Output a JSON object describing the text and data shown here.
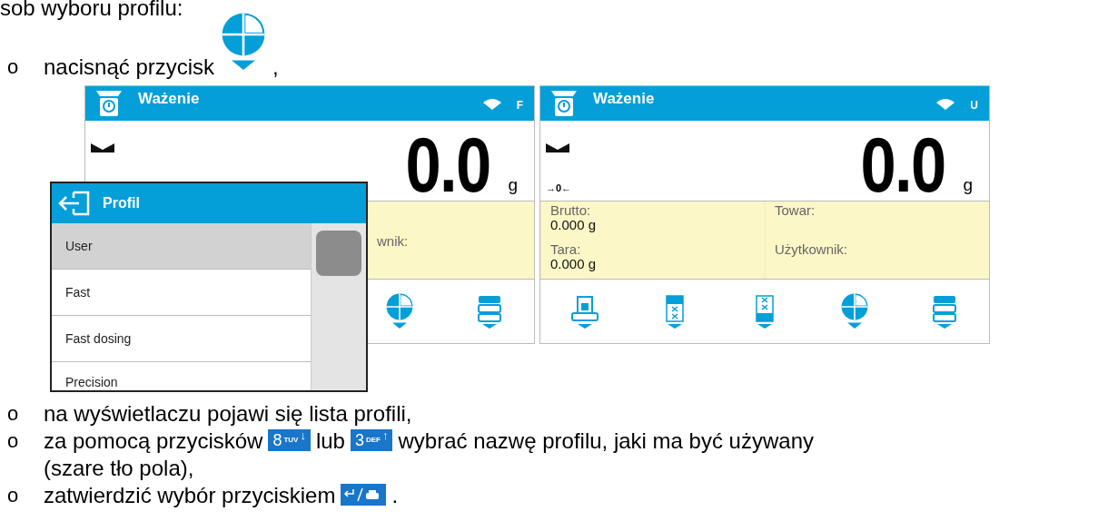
{
  "intro": "sob wyboru profilu:",
  "steps": [
    {
      "bullet": "o",
      "parts": [
        {
          "kind": "text",
          "text": "nacisnąć przycisk"
        },
        {
          "kind": "profile-key"
        },
        {
          "kind": "text",
          "text": ","
        }
      ]
    },
    {
      "bullet": "o",
      "parts": [
        {
          "kind": "text",
          "text": "na wyświetlaczu pojawi się lista profili,"
        }
      ]
    },
    {
      "bullet": "o",
      "parts": [
        {
          "kind": "text",
          "text": "za pomocą przycisków"
        },
        {
          "kind": "key",
          "digit": "8",
          "letters": "TUV",
          "arrow": "↓"
        },
        {
          "kind": "text",
          "text": "lub"
        },
        {
          "kind": "key",
          "digit": "3",
          "letters": "DEF",
          "arrow": "↑"
        },
        {
          "kind": "text",
          "text": "wybrać nazwę profilu, jaki ma być używany"
        },
        {
          "kind": "break"
        },
        {
          "kind": "text",
          "text": "(szare tło pola),"
        }
      ]
    },
    {
      "bullet": "o",
      "parts": [
        {
          "kind": "text",
          "text": "zatwierdzić wybór przyciskiem"
        },
        {
          "kind": "enter-key"
        },
        {
          "kind": "text",
          "text": "."
        }
      ]
    }
  ],
  "screens": [
    {
      "title": "Ważenie",
      "mode": "F",
      "value": "0.0",
      "unit": "g",
      "fields": [
        {
          "label": "wnik:"
        }
      ],
      "toolbar": [
        {
          "kind": "profile"
        },
        {
          "kind": "menu"
        }
      ],
      "popup": {
        "title": "Profil",
        "items": [
          {
            "label": "User",
            "selected": true
          },
          {
            "label": "Fast",
            "selected": false
          },
          {
            "label": "Fast dosing",
            "selected": false
          },
          {
            "label": "Precision",
            "selected": false
          }
        ]
      }
    },
    {
      "title": "Ważenie",
      "mode": "U",
      "zero": "→0←",
      "value": "0.0",
      "unit": "g",
      "fields": [
        {
          "label": "Brutto:",
          "value": "0.000 g"
        },
        {
          "label": "Towar:"
        },
        {
          "label": "Tara:",
          "value": "0.000 g"
        },
        {
          "label": "Użytkownik:"
        }
      ],
      "toolbar": [
        {
          "kind": "tare"
        },
        {
          "kind": "upper"
        },
        {
          "kind": "lower"
        },
        {
          "kind": "profile"
        },
        {
          "kind": "menu"
        }
      ]
    }
  ]
}
